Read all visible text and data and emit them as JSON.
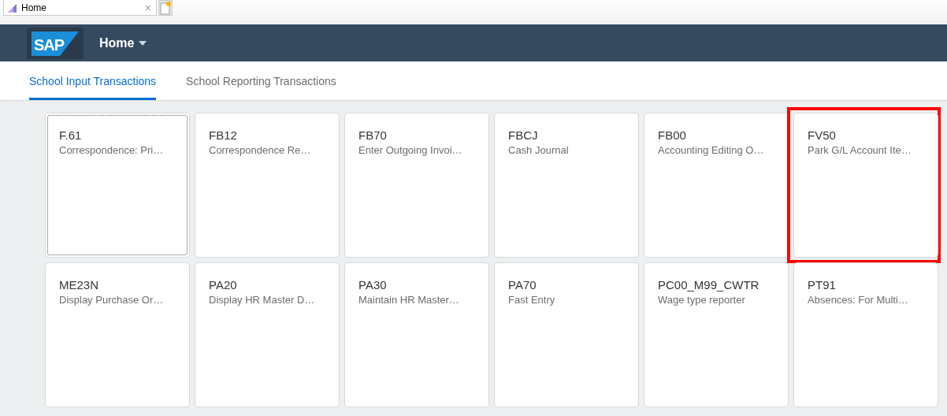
{
  "browser_tab": {
    "title": "Home",
    "close": "×"
  },
  "shell": {
    "logo": "SAP",
    "title": "Home"
  },
  "tabs": [
    {
      "label": "School Input Transactions",
      "selected": true
    },
    {
      "label": "School Reporting Transactions",
      "selected": false
    }
  ],
  "tiles": [
    {
      "title": "F.61",
      "subtitle": "Correspondence: Pri…",
      "focused": true,
      "highlighted": false
    },
    {
      "title": "FB12",
      "subtitle": "Correspondence Re…",
      "focused": false,
      "highlighted": false
    },
    {
      "title": "FB70",
      "subtitle": "Enter Outgoing Invoi…",
      "focused": false,
      "highlighted": false
    },
    {
      "title": "FBCJ",
      "subtitle": "Cash Journal",
      "focused": false,
      "highlighted": false
    },
    {
      "title": "FB00",
      "subtitle": "Accounting Editing O…",
      "focused": false,
      "highlighted": false
    },
    {
      "title": "FV50",
      "subtitle": "Park G/L Account Ite…",
      "focused": false,
      "highlighted": true
    },
    {
      "title": "ME23N",
      "subtitle": "Display Purchase Or…",
      "focused": false,
      "highlighted": false
    },
    {
      "title": "PA20",
      "subtitle": "Display HR Master D…",
      "focused": false,
      "highlighted": false
    },
    {
      "title": "PA30",
      "subtitle": "Maintain HR Master…",
      "focused": false,
      "highlighted": false
    },
    {
      "title": "PA70",
      "subtitle": "Fast Entry",
      "focused": false,
      "highlighted": false
    },
    {
      "title": "PC00_M99_CWTR",
      "subtitle": "Wage type reporter",
      "focused": false,
      "highlighted": false
    },
    {
      "title": "PT91",
      "subtitle": "Absences: For Multi…",
      "focused": false,
      "highlighted": false
    }
  ]
}
